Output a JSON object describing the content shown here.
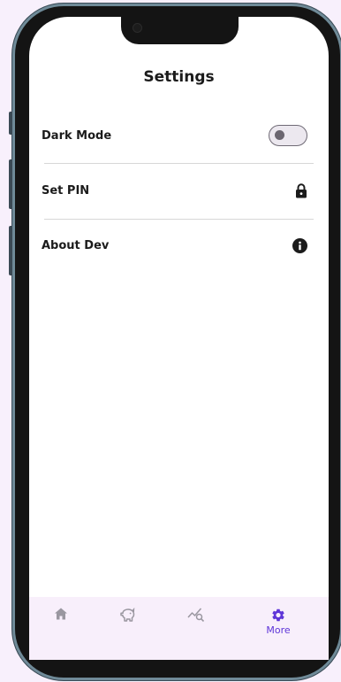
{
  "header": {
    "title": "Settings"
  },
  "settings": [
    {
      "label": "Dark Mode",
      "control": "toggle",
      "value": false
    },
    {
      "label": "Set PIN",
      "control": "icon",
      "icon": "lock-icon"
    },
    {
      "label": "About Dev",
      "control": "icon",
      "icon": "info-icon"
    }
  ],
  "bottom_nav": {
    "items": [
      {
        "icon": "home-icon",
        "label": "",
        "active": false
      },
      {
        "icon": "piggy-bank-icon",
        "label": "",
        "active": false
      },
      {
        "icon": "chart-search-icon",
        "label": "",
        "active": false
      },
      {
        "icon": "gear-icon",
        "label": "More",
        "active": true
      }
    ]
  },
  "colors": {
    "background": "#f8f0fc",
    "active_accent": "#5e35d8",
    "inactive_icon": "#9a97a0",
    "text": "#1b1b1b",
    "navbar_bg": "#f8effb"
  }
}
